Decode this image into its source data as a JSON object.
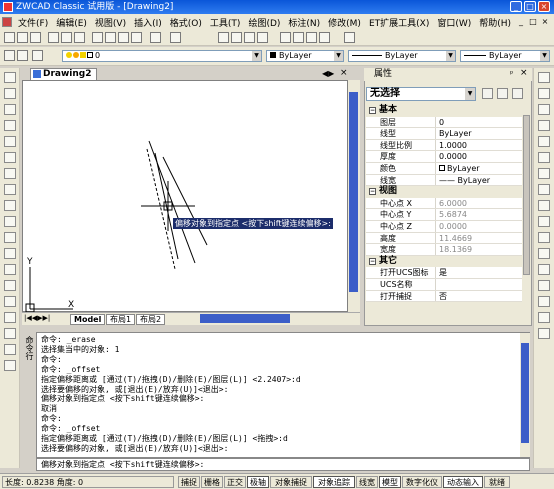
{
  "window": {
    "title": "ZWCAD Classic 试用版 - [Drawing2]",
    "minimize": "_",
    "maximize": "□",
    "close": "×"
  },
  "menu": {
    "items": [
      "文件(F)",
      "编辑(E)",
      "视图(V)",
      "插入(I)",
      "格式(O)",
      "工具(T)",
      "绘图(D)",
      "标注(N)",
      "修改(M)",
      "ET扩展工具(X)",
      "窗口(W)",
      "帮助(H)"
    ],
    "mdi_minimize": "_",
    "mdi_restore": "□",
    "mdi_close": "×"
  },
  "layer_toolbar": {
    "layer_value": "0",
    "color_value": "ByLayer",
    "linetype_value": "ByLayer",
    "lineweight_value": "ByLayer"
  },
  "drawing": {
    "tab_title": "Drawing2",
    "tooltip": "偏移对象到指定点 <按下shift键连续偏移>:",
    "axis_y": "Y",
    "axis_x": "X",
    "layout_tabs": [
      "Model",
      "布局1",
      "布局2"
    ]
  },
  "properties": {
    "title": "属性",
    "selection": "无选择",
    "categories": [
      {
        "name": "基本",
        "rows": [
          {
            "key": "图层",
            "value": "0"
          },
          {
            "key": "线型",
            "value": "ByLayer"
          },
          {
            "key": "线型比例",
            "value": "1.0000"
          },
          {
            "key": "厚度",
            "value": "0.0000"
          },
          {
            "key": "颜色",
            "value": "ByLayer"
          },
          {
            "key": "线宽",
            "value": "—— ByLayer"
          }
        ]
      },
      {
        "name": "视图",
        "rows": [
          {
            "key": "中心点 X",
            "value": "6.0000"
          },
          {
            "key": "中心点 Y",
            "value": "5.6874"
          },
          {
            "key": "中心点 Z",
            "value": "0.0000"
          },
          {
            "key": "高度",
            "value": "11.4669"
          },
          {
            "key": "宽度",
            "value": "18.1369"
          }
        ]
      },
      {
        "name": "其它",
        "rows": [
          {
            "key": "打开UCS图标",
            "value": "是"
          },
          {
            "key": "UCS名称",
            "value": ""
          },
          {
            "key": "打开捕捉",
            "value": "否"
          }
        ]
      }
    ]
  },
  "command": {
    "label": "命令行",
    "lines": [
      "命令: _erase",
      "选择集当中的对象: 1",
      "命令:",
      "命令: _offset",
      "指定偏移距离或 [通过(T)/拖拽(D)/删除(E)/图层(L)] <2.2407>:d",
      "选择要偏移的对象, 或[退出(E)/放弃(U)]<退出>:",
      "偏移对象到指定点 <按下shift键连续偏移>:",
      "取消",
      "命令:",
      "命令: _offset",
      "指定偏移距离或 [通过(T)/拖拽(D)/删除(E)/图层(L)] <拖拽>:d",
      "选择要偏移的对象, 或[退出(E)/放弃(U)]<退出>:"
    ],
    "input": "偏移对象到指定点 <按下shift键连续偏移>:"
  },
  "status": {
    "coords": "长度: 0.8238 角度: 0",
    "buttons": [
      {
        "label": "捕捉",
        "on": false
      },
      {
        "label": "栅格",
        "on": false
      },
      {
        "label": "正交",
        "on": false
      },
      {
        "label": "极轴",
        "on": true
      },
      {
        "label": "对象捕捉",
        "on": false
      },
      {
        "label": "对象追踪",
        "on": true
      },
      {
        "label": "线宽",
        "on": false
      },
      {
        "label": "模型",
        "on": true
      },
      {
        "label": "数字化仪",
        "on": false
      },
      {
        "label": "动态输入",
        "on": true
      },
      {
        "label": "就绪",
        "on": false
      }
    ]
  }
}
